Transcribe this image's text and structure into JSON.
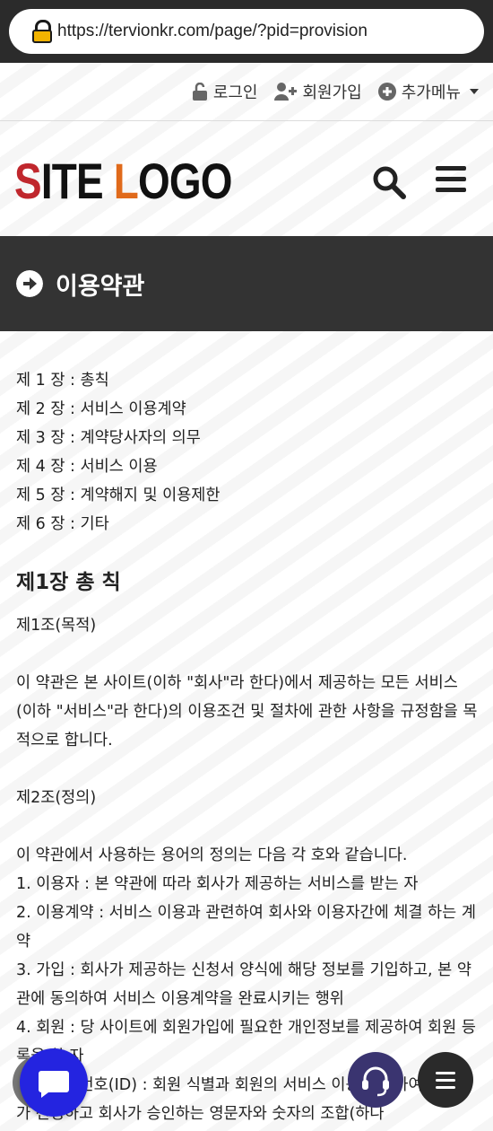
{
  "browser": {
    "url": "https://tervionkr.com/page/?pid=provision"
  },
  "topnav": {
    "login": "로그인",
    "signup": "회원가입",
    "more": "추가메뉴"
  },
  "header": {
    "logo_part1": "S",
    "logo_part2": "ITE ",
    "logo_part3": "L",
    "logo_part4": "OGO"
  },
  "title": "이용약관",
  "toc": [
    "제 1 장 : 총칙",
    "제 2 장 : 서비스 이용계약",
    "제 3 장 : 계약당사자의 의무",
    "제 4 장 : 서비스 이용",
    "제 5 장 : 계약해지 및 이용제한",
    "제 6 장 : 기타"
  ],
  "section1": {
    "heading": "제1장 총 칙",
    "art1_title": "제1조(목적)",
    "art1_text": "이 약관은 본 사이트(이하 \"회사\"라 한다)에서 제공하는 모든 서비스(이하 \"서비스\"라 한다)의 이용조건 및 절차에 관한 사항을 규정함을 목적으로 합니다.",
    "art2_title": "제2조(정의)",
    "art2_intro": "이 약관에서 사용하는 용어의 정의는 다음 각 호와 같습니다.",
    "art2_items": [
      "1. 이용자 : 본 약관에 따라 회사가 제공하는 서비스를 받는 자",
      "2. 이용계약 : 서비스 이용과 관련하여 회사와 이용자간에 체결 하는 계약",
      "3. 가입 : 회사가 제공하는 신청서 양식에 해당 정보를 기입하고, 본 약관에 동의하여 서비스 이용계약을 완료시키는 행위",
      "4. 회원 : 당 사이트에 회원가입에 필요한 개인정보를 제공하여 회원 등록을 한 자",
      "5. 이용자번호(ID) : 회원 식별과 회원의 서비스 이용을 위하여 이용자가 선정하고 회사가 승인하는 영문자와 숫자의 조합(하나"
    ]
  },
  "icons": {
    "lock": "lock-icon",
    "login": "unlock-icon",
    "signup": "user-plus-icon",
    "more": "plus-circle-icon",
    "search": "search-icon",
    "menu": "hamburger-icon",
    "title": "arrow-right-circle-icon",
    "chat": "chat-icon",
    "support": "headset-icon"
  },
  "colors": {
    "title_bar": "#333333",
    "logo_red": "#c0272d",
    "logo_orange": "#e06a1b",
    "chat_fab": "#2424e0"
  }
}
